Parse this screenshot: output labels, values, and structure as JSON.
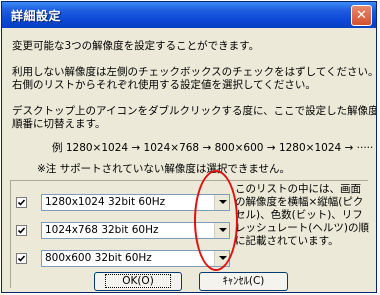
{
  "window": {
    "title": "詳細設定",
    "close_label": "✕"
  },
  "text": {
    "intro": "変更可能な3つの解像度を設定することができます。",
    "line2a": "利用しない解像度は左側のチェックボックスのチェックをはずしてください。",
    "line2b": "右側のリストからそれぞれ使用する設定値を選択してください。",
    "line3a": "デスクトップ上のアイコンをダブルクリックする度に、ここで設定した解像度を",
    "line3b": "順番に切替えます。",
    "example": "例  1280×1024 → 1024×768 → 800×600 → 1280×1024 → ·····",
    "note": "※注  サポートされていない解像度は選択できません。"
  },
  "rows": [
    {
      "checked": true,
      "value": "1280x1024 32bit 60Hz"
    },
    {
      "checked": true,
      "value": "1024x768 32bit 60Hz"
    },
    {
      "checked": true,
      "value": "800x600 32bit 60Hz"
    }
  ],
  "description": "このリストの中には、画面の解像度を横幅×縦幅(ピクセル)、色数(ビット)、リフレッシュレート(ヘルツ)の順に記載されています。",
  "buttons": {
    "ok": "OK(O)",
    "cancel": "ｷｬﾝｾﾙ(C)"
  },
  "colors": {
    "titlebar": "#0b48d6",
    "dialog_bg": "#ece9d8",
    "annotation_circle": "#e01010"
  }
}
